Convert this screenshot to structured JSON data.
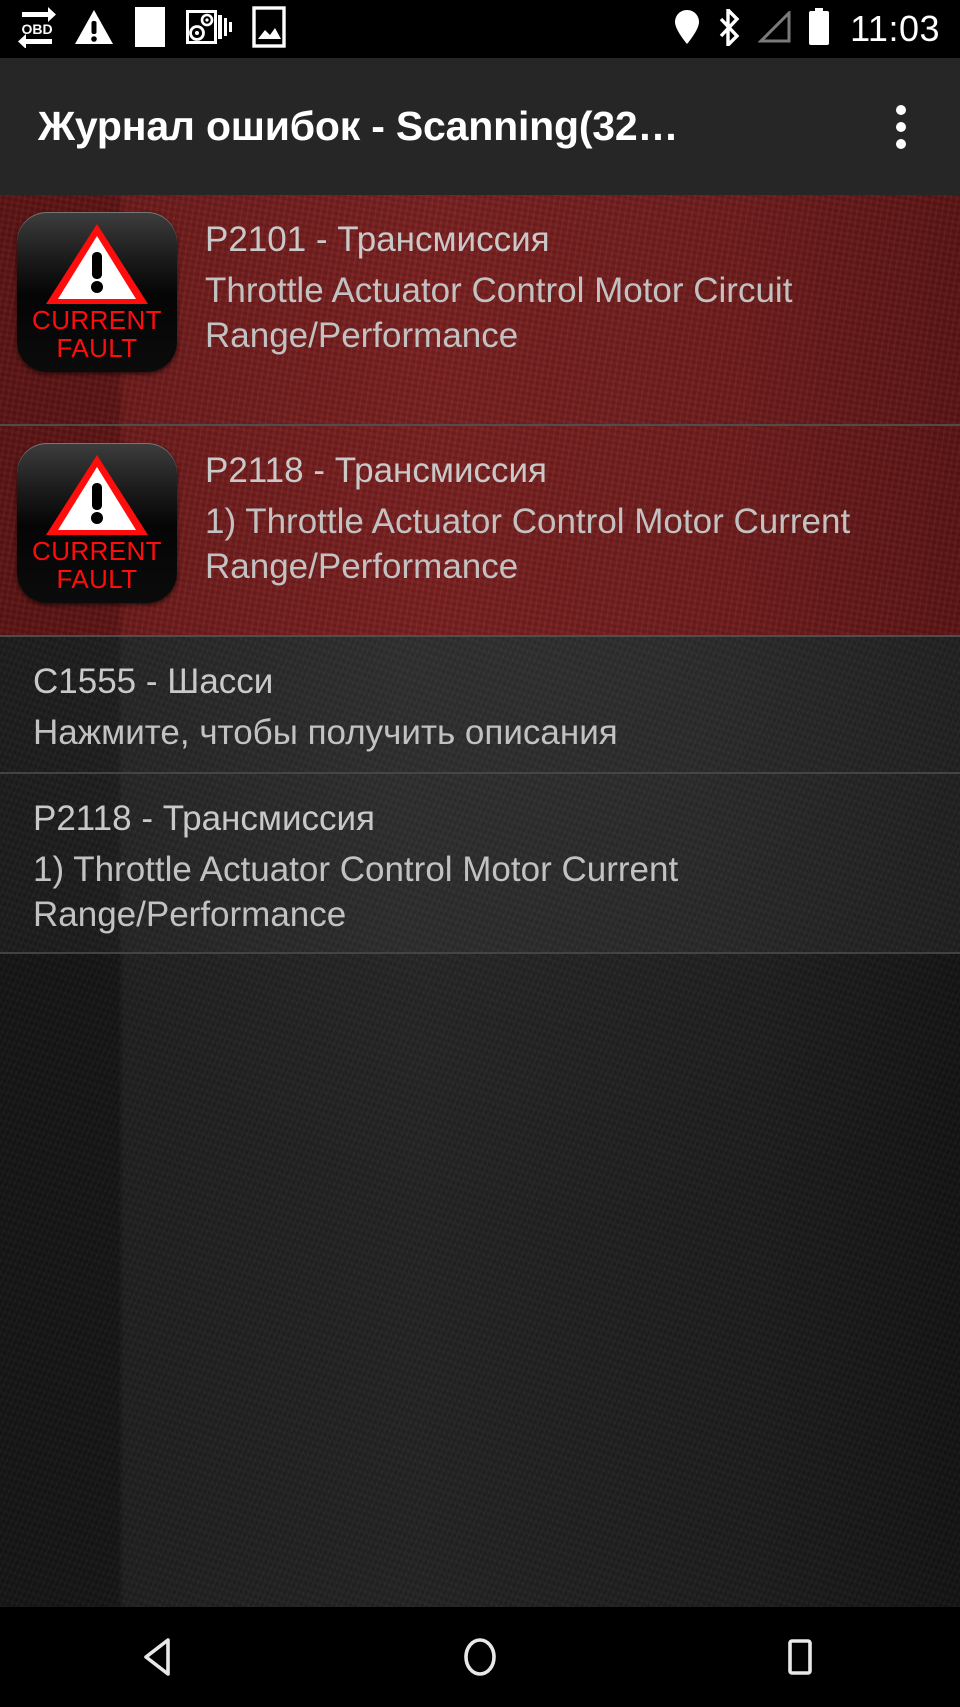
{
  "status_bar": {
    "icons": [
      {
        "name": "obd-sync-icon",
        "label": "OBD"
      },
      {
        "name": "warning-triangle-icon",
        "label": "warning"
      },
      {
        "name": "blank-page-icon",
        "label": "page"
      },
      {
        "name": "dual-gauge-icon",
        "label": "gauges"
      },
      {
        "name": "image-icon",
        "label": "screenshot"
      }
    ],
    "right_icons": [
      {
        "name": "location-pin-icon",
        "label": "location"
      },
      {
        "name": "bluetooth-icon",
        "label": "bluetooth"
      },
      {
        "name": "signal-icon",
        "label": "signal"
      },
      {
        "name": "battery-icon",
        "label": "battery"
      }
    ],
    "clock": "11:03"
  },
  "app_bar": {
    "title": "Журнал ошибок - Scanning(32…",
    "overflow_label": "Ещё"
  },
  "colors": {
    "fault_row_bg": "#6e1b1b",
    "normal_row_bg": "#242424",
    "appbar_bg": "#262626",
    "fault_red": "#ff0d0d",
    "text_primary": "#c9c9c9"
  },
  "list": {
    "rows": [
      {
        "badge": {
          "line1": "CURRENT",
          "line2": "FAULT",
          "icon": "warning-triangle-icon"
        },
        "has_badge": true,
        "code": "P2101 - Трансмиссия",
        "description": "Throttle Actuator Control Motor Circuit Range/Performance"
      },
      {
        "badge": {
          "line1": "CURRENT",
          "line2": "FAULT",
          "icon": "warning-triangle-icon"
        },
        "has_badge": true,
        "code": "P2118 - Трансмиссия",
        "description": "1) Throttle Actuator Control Motor Current Range/Performance"
      },
      {
        "has_badge": false,
        "code": "C1555 - Шасси",
        "description": "Нажмите, чтобы получить описания"
      },
      {
        "has_badge": false,
        "code": "P2118 - Трансмиссия",
        "description": "1) Throttle Actuator Control Motor Current Range/Performance"
      }
    ]
  },
  "nav_bar": {
    "back_label": "Назад",
    "home_label": "Главный экран",
    "recents_label": "Обзор"
  }
}
